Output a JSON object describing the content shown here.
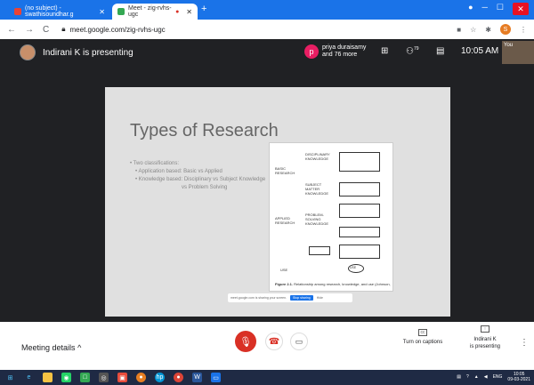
{
  "browser": {
    "tabs": [
      {
        "label": "(no subject) - swathisoundhar.g",
        "active": false
      },
      {
        "label": "Meet - zig-rvhs-ugc",
        "active": true
      }
    ],
    "new_tab": "+",
    "url": "meet.google.com/zig-rvhs-ugc"
  },
  "meet": {
    "presenting_label": "Indirani K is presenting",
    "participants_initial": "p",
    "participants_line1": "priya duraisamy",
    "participants_line2": "and 76 more",
    "people_count": "79",
    "clock": "10:05 AM",
    "self_tile": "You"
  },
  "slide": {
    "title": "Types of Research",
    "bullets": [
      {
        "level": 1,
        "text": "Two classifications:"
      },
      {
        "level": 2,
        "text": "Application based: Basic vs Applied"
      },
      {
        "level": 2,
        "text": "Knowledge based: Disciplinary vs Subject Knowledge"
      },
      {
        "level": 3,
        "text": "vs Problem Solving"
      }
    ],
    "diagram": {
      "basic_research": "BASIC RESEARCH",
      "applied_research": "APPLIED RESEARCH",
      "disciplinary": "DISCIPLINARY KNOWLEDGE",
      "subject_matter": "SUBJECT MATTER KNOWLEDGE",
      "problem_solving": "PROBLEM-SOLVING KNOWLEDGE",
      "use": "USE",
      "use2": "USE",
      "caption_label": "Figure 2.1.",
      "caption_text": "Relationship among research, knowledge, and use (Johnson,"
    },
    "share_bar_text": "meet.google.com is sharing your screen.",
    "share_stop": "Stop sharing",
    "share_hide": "Hide"
  },
  "controls": {
    "meeting_details": "Meeting details",
    "captions_label": "Turn on captions",
    "presenting_name": "Indirani K",
    "presenting_sub": "is presenting"
  },
  "taskbar": {
    "lang": "ENG",
    "time": "10:05",
    "date": "09-03-2021"
  }
}
